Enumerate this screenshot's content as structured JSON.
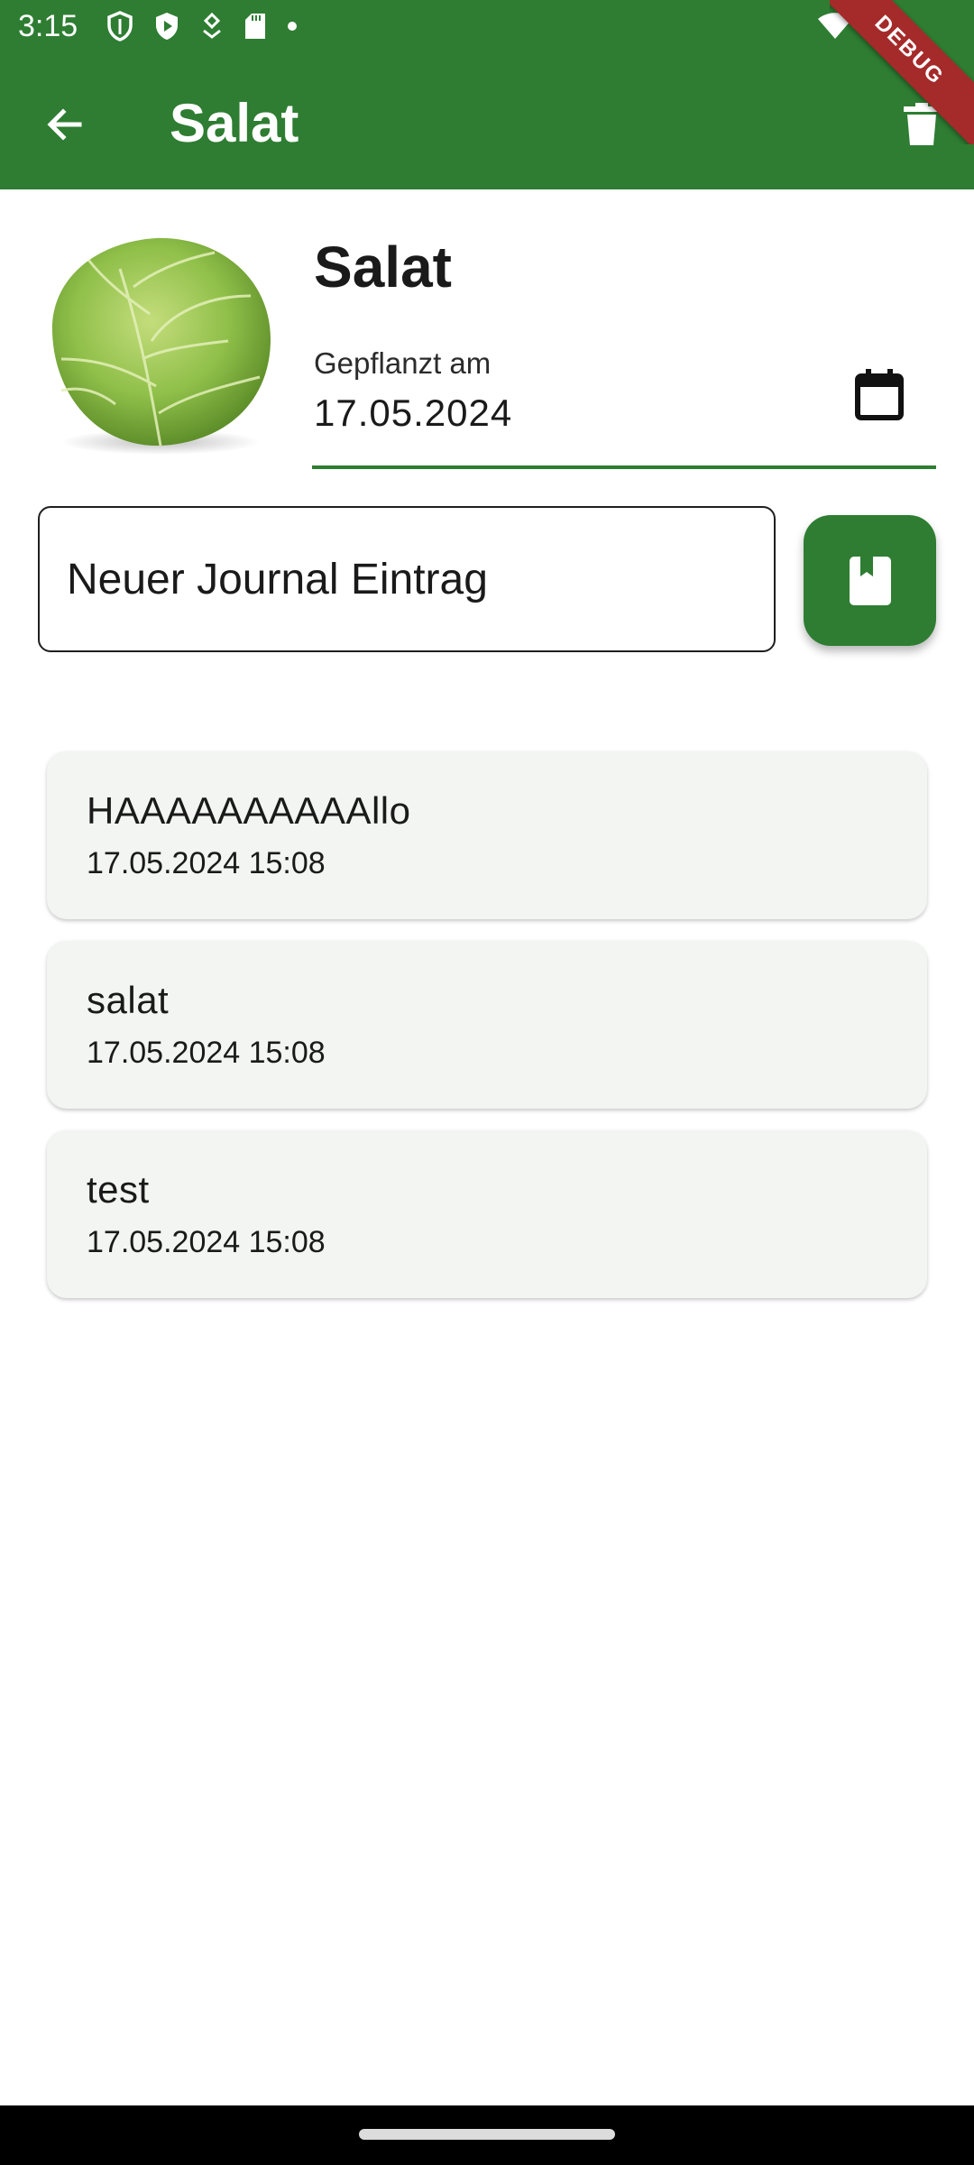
{
  "status_bar": {
    "time": "3:15",
    "icons": [
      "shield-outline-icon",
      "shield-play-icon",
      "tag-icon",
      "sd-card-icon",
      "dot-icon"
    ],
    "right_icons": [
      "wifi-icon",
      "cell-signal-icon"
    ]
  },
  "debug_banner": "DEBUG",
  "app_bar": {
    "title": "Salat",
    "background": "#2e7d32"
  },
  "plant": {
    "name": "Salat",
    "planted_label": "Gepflanzt am",
    "planted_date": "17.05.2024"
  },
  "journal": {
    "input_placeholder": "Neuer Journal Eintrag",
    "input_value": ""
  },
  "entries": [
    {
      "text": "HAAAAAAAAAAllo",
      "timestamp": "17.05.2024 15:08"
    },
    {
      "text": "salat",
      "timestamp": "17.05.2024 15:08"
    },
    {
      "text": "test",
      "timestamp": "17.05.2024 15:08"
    }
  ],
  "colors": {
    "primary": "#2e7d32",
    "card": "#f2f5f1",
    "debug": "#a52a2a"
  }
}
